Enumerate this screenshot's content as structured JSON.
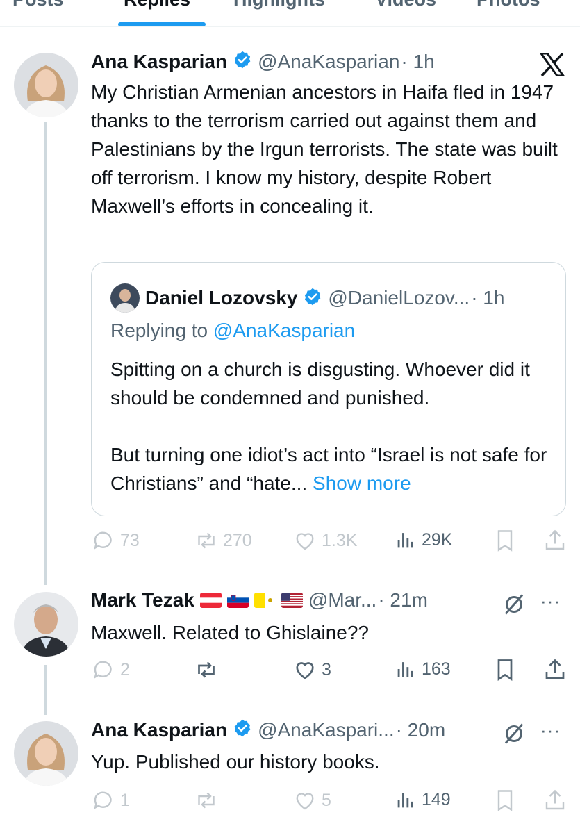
{
  "tabs": [
    {
      "label": "Posts"
    },
    {
      "label": "Replies"
    },
    {
      "label": "Highlights"
    },
    {
      "label": "Videos"
    },
    {
      "label": "Photos"
    }
  ],
  "colors": {
    "accent": "#1d9bf0",
    "muted": "#536471",
    "text": "#0f1419",
    "border": "#cfd9de"
  },
  "post1": {
    "name": "Ana Kasparian",
    "handle": "@AnaKasparian",
    "time": "· 1h",
    "icon": "x-logo-icon",
    "body": "My Christian Armenian ancestors in Haifa fled in 1947 thanks to the terrorism carried out against them and Palestinians by the Irgun terrorists. The state was built off terrorism. I know my history, despite Robert Maxwell’s efforts in concealing it.",
    "quote": {
      "name": "Daniel Lozovsky",
      "handle": "@DanielLozov...",
      "time": "· 1h",
      "replying_prefix": "Replying to ",
      "replying_handle": "@AnaKasparian",
      "para1": "Spitting on a church is disgusting. Whoever did it should be condemned and punished.",
      "para2": "But turning one idiot’s act into “Israel is not safe for Christians” and “hate...",
      "show_more": "Show more"
    },
    "stats": {
      "replies": "73",
      "reposts": "270",
      "likes": "1.3K",
      "views": "29K"
    }
  },
  "post2": {
    "name": "Mark Tezak",
    "flags": [
      "austria-flag",
      "slovenia-flag",
      "vatican-flag",
      "usa-flag"
    ],
    "handle": "@Mar...",
    "time": "· 21m",
    "body": "Maxwell.  Related to Ghislaine??",
    "stats": {
      "replies": "2",
      "reposts": "",
      "likes": "3",
      "views": "163"
    }
  },
  "post3": {
    "name": "Ana Kasparian",
    "handle": "@AnaKaspari...",
    "time": "· 20m",
    "body": "Yup. Published our history books.",
    "stats": {
      "replies": "1",
      "reposts": "",
      "likes": "5",
      "views": "149"
    }
  }
}
